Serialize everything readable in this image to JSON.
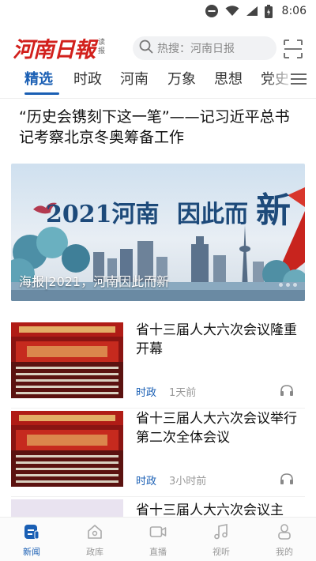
{
  "status_bar": {
    "time": "8:06"
  },
  "header": {
    "logo_text": "河南日報",
    "logo_sub_1": "读",
    "logo_sub_2": "报",
    "search_placeholder": "热搜：河南日报"
  },
  "tabs": [
    {
      "label": "精选",
      "active": true
    },
    {
      "label": "时政"
    },
    {
      "label": "河南"
    },
    {
      "label": "万象"
    },
    {
      "label": "思想"
    },
    {
      "label": "党史"
    }
  ],
  "headline": "“历史会镌刻下这一笔”——记习近平总书记考察北京冬奥筹备工作",
  "banner": {
    "title_main": "2021河南",
    "title_mid": "因此而",
    "title_big": "新",
    "caption": "海报|2021，河南因此而新"
  },
  "articles": [
    {
      "title": "省十三届人大六次会议隆重开幕",
      "category": "时政",
      "time": "1天前"
    },
    {
      "title": "省十三届人大六次会议举行第二次全体会议",
      "category": "时政",
      "time": "3小时前"
    },
    {
      "title": "省十三届人大六次会议主",
      "category": "",
      "time": ""
    }
  ],
  "bottom_nav": [
    {
      "label": "新闻",
      "icon": "news-icon",
      "active": true
    },
    {
      "label": "政库",
      "icon": "home-icon"
    },
    {
      "label": "直播",
      "icon": "video-camera-icon"
    },
    {
      "label": "视听",
      "icon": "music-note-icon"
    },
    {
      "label": "我的",
      "icon": "person-icon"
    }
  ],
  "colors": {
    "brand_red": "#d2201c",
    "accent_blue": "#1a5fb4"
  }
}
